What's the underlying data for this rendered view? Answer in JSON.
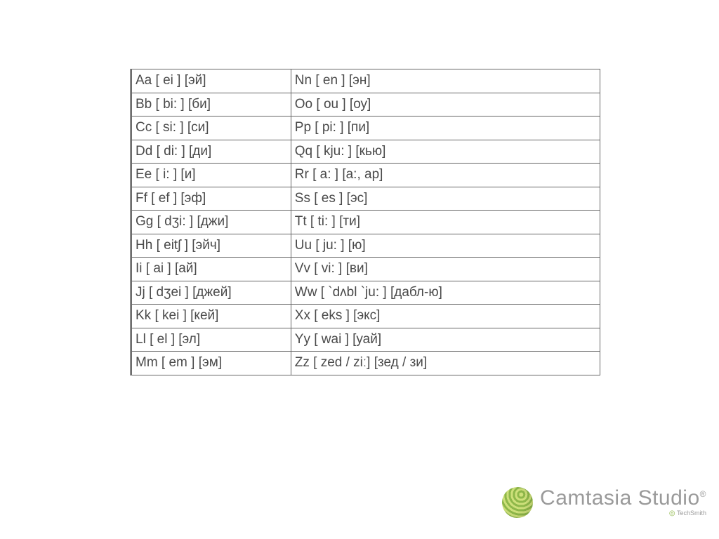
{
  "alphabet": {
    "rows": [
      {
        "left": "Aa [ ei ] [эй]",
        "right": "Nn [ en ] [эн]"
      },
      {
        "left": "Bb [ bi: ] [би]",
        "right": "Oo [ ou ] [оу]"
      },
      {
        "left": "Cc [ si: ] [си]",
        "right": "Pp [ pi: ] [пи]"
      },
      {
        "left": "Dd [ di: ] [ди]",
        "right": "Qq [ kju: ] [кью]"
      },
      {
        "left": "Ee [ i: ] [и]",
        "right": "Rr [ a: ] [а:, ар]"
      },
      {
        "left": "Ff [ ef ] [эф]",
        "right": "Ss [ es ] [эс]"
      },
      {
        "left": "Gg [ dʒi: ] [джи]",
        "right": "Tt [ ti: ] [ти]"
      },
      {
        "left": "Hh [ eitʃ ] [эйч]",
        "right": "Uu [ ju: ] [ю]"
      },
      {
        "left": "Ii [ ai ] [ай]",
        "right": "Vv [ vi: ] [ви]"
      },
      {
        "left": "Jj [ dʒei ] [джей]",
        "right": "Ww [ `dʌbl `ju: ] [дабл-ю]"
      },
      {
        "left": "Kk [ kei ] [кей]",
        "right": "Xx [ eks ] [экс]"
      },
      {
        "left": "Ll [ el ] [эл]",
        "right": "Yy [ wai ] [уай]"
      },
      {
        "left": "Mm [ em ] [эм]",
        "right": "Zz [ zed / ziː] [зед / зи]"
      }
    ]
  },
  "watermark": {
    "title": "Camtasia Studio",
    "reg": "®",
    "sub_prefix": "◎",
    "sub_text": "TechSmith"
  }
}
